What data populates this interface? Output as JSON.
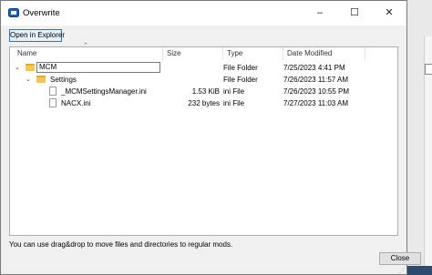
{
  "window": {
    "title": "Overwrite",
    "minimize_glyph": "–",
    "maximize_glyph": "☐",
    "close_glyph": "✕"
  },
  "toolbar": {
    "open_in_explorer_label": "Open in Explorer"
  },
  "columns": {
    "name": "Name",
    "size": "Size",
    "type": "Type",
    "date": "Date Modified"
  },
  "rows": [
    {
      "name": "MCM",
      "size": "",
      "type": "File Folder",
      "date": "7/25/2023 4:41 PM",
      "kind": "folder",
      "expanded": true,
      "editing": true
    },
    {
      "name": "Settings",
      "size": "",
      "type": "File Folder",
      "date": "7/26/2023 11:57 AM",
      "kind": "folder",
      "expanded": true
    },
    {
      "name": "_MCMSettingsManager.ini",
      "size": "1.53 KiB",
      "type": "ini File",
      "date": "7/26/2023 10:55 PM",
      "kind": "file"
    },
    {
      "name": "NACX.ini",
      "size": "232 bytes",
      "type": "ini File",
      "date": "7/27/2023 11:03 AM",
      "kind": "file"
    }
  ],
  "status_text": "You can use drag&drop to move files and directories to regular mods.",
  "close_label": "Close",
  "colors": {
    "accent": "#2f72c4",
    "folder": "#f4c752"
  }
}
